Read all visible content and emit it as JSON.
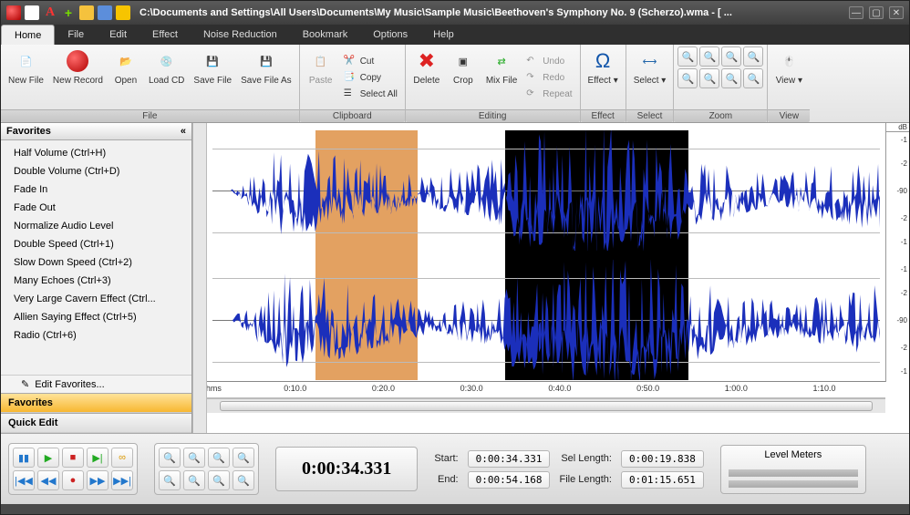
{
  "title": "C:\\Documents and Settings\\All Users\\Documents\\My Music\\Sample Music\\Beethoven's Symphony No. 9 (Scherzo).wma - [ ...",
  "menus": [
    "Home",
    "File",
    "Edit",
    "Effect",
    "Noise Reduction",
    "Bookmark",
    "Options",
    "Help"
  ],
  "ribbon": {
    "file": {
      "label": "File",
      "new_file": "New\nFile",
      "new_record": "New\nRecord",
      "open": "Open",
      "load_cd": "Load\nCD",
      "save_file": "Save\nFile",
      "save_as": "Save\nFile As"
    },
    "clipboard": {
      "label": "Clipboard",
      "paste": "Paste",
      "cut": "Cut",
      "copy": "Copy",
      "select_all": "Select All"
    },
    "editing": {
      "label": "Editing",
      "delete": "Delete",
      "crop": "Crop",
      "mix_file": "Mix\nFile",
      "undo": "Undo",
      "redo": "Redo",
      "repeat": "Repeat"
    },
    "effect": {
      "label": "Effect",
      "effect": "Effect"
    },
    "select": {
      "label": "Select",
      "select": "Select"
    },
    "zoom": {
      "label": "Zoom"
    },
    "view": {
      "label": "View",
      "view": "View"
    }
  },
  "sidebar": {
    "header": "Favorites",
    "items": [
      "Half Volume (Ctrl+H)",
      "Double Volume (Ctrl+D)",
      "Fade In",
      "Fade Out",
      "Normalize Audio Level",
      "Double Speed (Ctrl+1)",
      "Slow Down Speed (Ctrl+2)",
      "Many Echoes (Ctrl+3)",
      "Very Large Cavern Effect (Ctrl...",
      "Allien Saying Effect (Ctrl+5)",
      "Radio (Ctrl+6)"
    ],
    "edit": "Edit Favorites...",
    "tabs": [
      "Favorites",
      "Quick Edit"
    ]
  },
  "timeline": {
    "unit": "hms",
    "ticks": [
      "0:10.0",
      "0:20.0",
      "0:30.0",
      "0:40.0",
      "0:50.0",
      "1:00.0",
      "1:10.0"
    ]
  },
  "db": {
    "header": "dB",
    "ticks": [
      "-1",
      "-2",
      "-90",
      "-2",
      "-1"
    ]
  },
  "status": {
    "timecode": "0:00:34.331",
    "start_lbl": "Start:",
    "start": "0:00:34.331",
    "end_lbl": "End:",
    "end": "0:00:54.168",
    "sel_lbl": "Sel Length:",
    "sel": "0:00:19.838",
    "flen_lbl": "File Length:",
    "flen": "0:01:15.651",
    "meters": "Level Meters"
  }
}
